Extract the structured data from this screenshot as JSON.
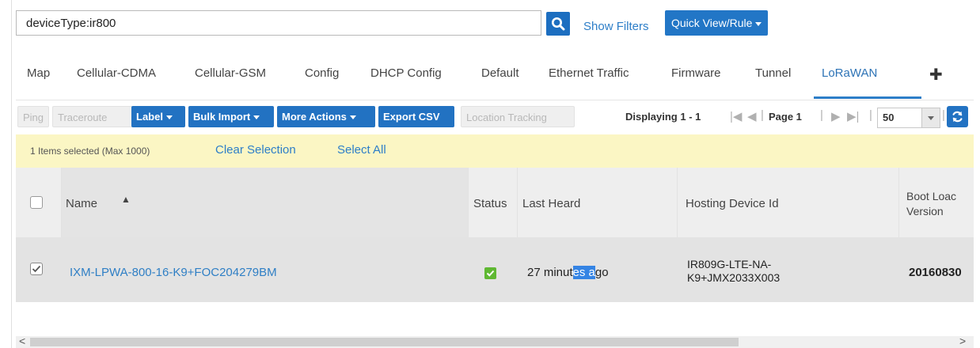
{
  "search": {
    "query": "deviceType:ir800",
    "show_filters_label": "Show Filters",
    "quick_view_label": "Quick View/Rule"
  },
  "tabs": [
    {
      "label": "Map",
      "active": false
    },
    {
      "label": "Cellular-CDMA",
      "active": false
    },
    {
      "label": "Cellular-GSM",
      "active": false
    },
    {
      "label": "Config",
      "active": false
    },
    {
      "label": "DHCP Config",
      "active": false
    },
    {
      "label": "Default",
      "active": false
    },
    {
      "label": "Ethernet Traffic",
      "active": false
    },
    {
      "label": "Firmware",
      "active": false
    },
    {
      "label": "Tunnel",
      "active": false
    },
    {
      "label": "LoRaWAN",
      "active": true
    }
  ],
  "add_tab_symbol": "✚",
  "toolbar": {
    "ping": "Ping",
    "traceroute": "Traceroute",
    "label": "Label",
    "bulk_import": "Bulk Import",
    "more_actions": "More Actions",
    "export_csv": "Export CSV",
    "location_tracking": "Location Tracking"
  },
  "paging": {
    "displaying": "Displaying 1 - 1",
    "page": "Page 1",
    "page_size": "50"
  },
  "selection": {
    "count_text": "1 Items selected (Max 1000)",
    "clear_label": "Clear Selection",
    "select_all_label": "Select All"
  },
  "table": {
    "headers": {
      "name": "Name",
      "status": "Status",
      "last_heard": "Last Heard",
      "hosting_device_id": "Hosting Device Id",
      "boot_loader_1": "Boot Loac",
      "boot_loader_2": "Version"
    },
    "rows": [
      {
        "name": "IXM-LPWA-800-16-K9+FOC204279BM",
        "last_heard_pre": "27 minut",
        "last_heard_hl": "es a",
        "last_heard_post": "go",
        "hosting_1": "IR809G-LTE-NA-",
        "hosting_2": "K9+JMX2033X003",
        "boot_loader": "20160830"
      }
    ]
  },
  "colors": {
    "primary_blue": "#2272c2",
    "link_blue": "#2d7ec8",
    "selection_bg": "#fbf6c4",
    "status_green": "#5fb832"
  }
}
